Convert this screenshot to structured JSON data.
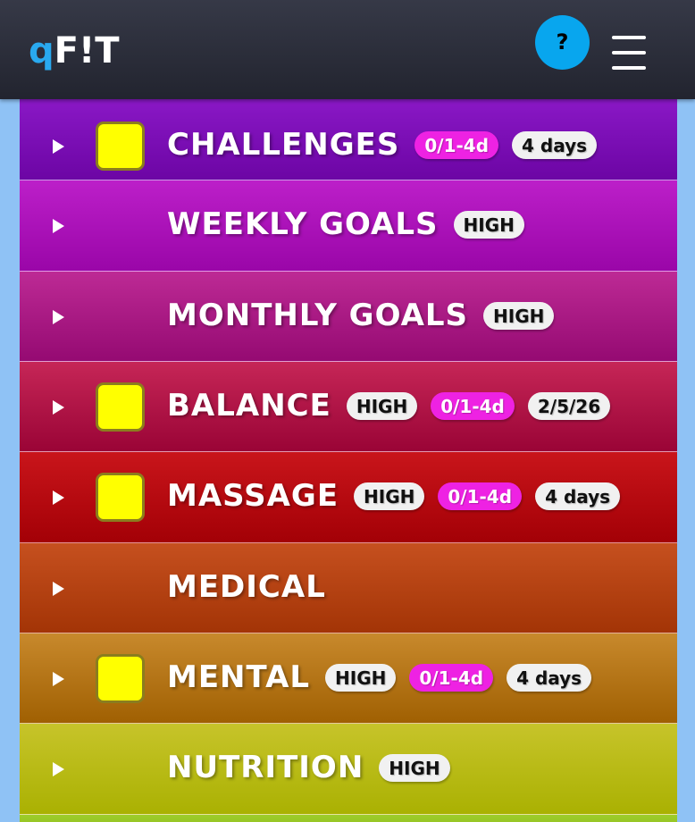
{
  "header": {
    "logo_q": "q",
    "logo_rest": "F!T",
    "help_label": "?",
    "menu_icon": "hamburger-menu-icon"
  },
  "categories": [
    {
      "title": "CHALLENGES",
      "has_checkbox": true,
      "badges": [
        {
          "text": "0/1-4d",
          "style": "pink"
        },
        {
          "text": "4 days",
          "style": "white"
        }
      ],
      "colors": [
        "#8a18c6",
        "#6c05a4"
      ]
    },
    {
      "title": "WEEKLY GOALS",
      "has_checkbox": false,
      "badges": [
        {
          "text": "HIGH",
          "style": "white"
        }
      ],
      "colors": [
        "#bc1fc9",
        "#9a06a8"
      ]
    },
    {
      "title": "MONTHLY GOALS",
      "has_checkbox": false,
      "badges": [
        {
          "text": "HIGH",
          "style": "white"
        }
      ],
      "colors": [
        "#bd2a95",
        "#950a72"
      ]
    },
    {
      "title": "BALANCE",
      "has_checkbox": true,
      "badges": [
        {
          "text": "HIGH",
          "style": "white"
        },
        {
          "text": "0/1-4d",
          "style": "pink"
        },
        {
          "text": "2/5/26",
          "style": "white"
        }
      ],
      "colors": [
        "#c62657",
        "#9a0436"
      ]
    },
    {
      "title": "MASSAGE",
      "has_checkbox": true,
      "badges": [
        {
          "text": "HIGH",
          "style": "white"
        },
        {
          "text": "0/1-4d",
          "style": "pink"
        },
        {
          "text": "4 days",
          "style": "white"
        }
      ],
      "colors": [
        "#c9151b",
        "#a30006"
      ]
    },
    {
      "title": "MEDICAL",
      "has_checkbox": false,
      "badges": [],
      "colors": [
        "#c6501f",
        "#a33406"
      ]
    },
    {
      "title": "MENTAL",
      "has_checkbox": true,
      "badges": [
        {
          "text": "HIGH",
          "style": "white"
        },
        {
          "text": "0/1-4d",
          "style": "pink"
        },
        {
          "text": "4 days",
          "style": "white"
        }
      ],
      "colors": [
        "#c8892c",
        "#a06002"
      ]
    },
    {
      "title": "NUTRITION",
      "has_checkbox": false,
      "badges": [
        {
          "text": "HIGH",
          "style": "white"
        }
      ],
      "colors": [
        "#c7c42a",
        "#aab102"
      ]
    },
    {
      "title": "",
      "has_checkbox": false,
      "badges": [],
      "colors": [
        "#9dcc2a",
        "#8ab91b"
      ]
    }
  ]
}
